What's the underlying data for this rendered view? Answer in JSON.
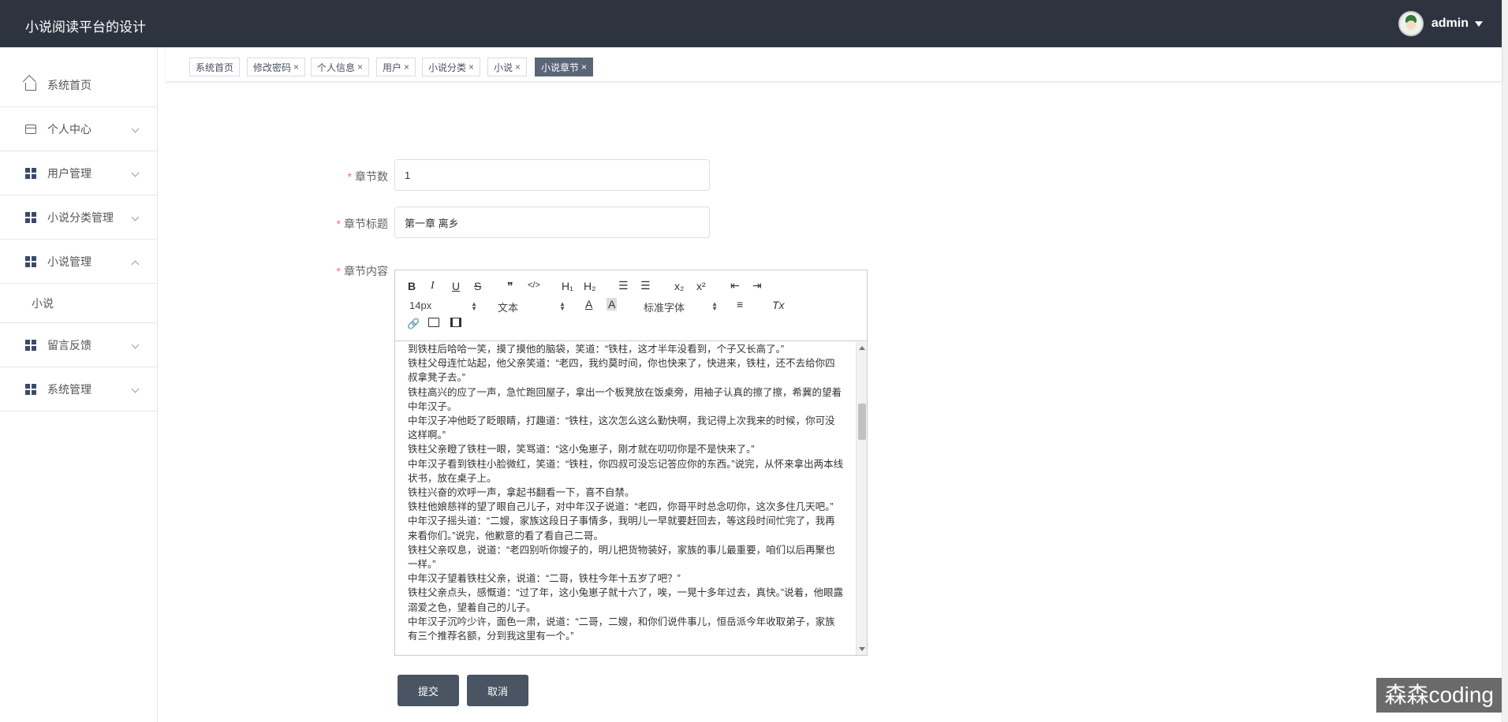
{
  "header": {
    "app_title": "小说阅读平台的设计",
    "user_name": "admin"
  },
  "sidebar": {
    "items": [
      {
        "label": "系统首页",
        "icon": "home-icon"
      },
      {
        "label": "个人中心",
        "icon": "card-icon"
      },
      {
        "label": "用户管理",
        "icon": "grid-icon"
      },
      {
        "label": "小说分类管理",
        "icon": "grid-icon"
      },
      {
        "label": "小说管理",
        "icon": "grid-icon"
      },
      {
        "label": "留言反馈",
        "icon": "grid-icon"
      },
      {
        "label": "系统管理",
        "icon": "grid-icon"
      }
    ],
    "submenu_novel": "小说"
  },
  "tags": [
    {
      "label": "系统首页"
    },
    {
      "label": "修改密码"
    },
    {
      "label": "个人信息"
    },
    {
      "label": "用户"
    },
    {
      "label": "小说分类"
    },
    {
      "label": "小说"
    },
    {
      "label": "小说章节"
    }
  ],
  "tag_close": "×",
  "form": {
    "chapter_num_label": "章节数",
    "chapter_num_value": "1",
    "chapter_title_label": "章节标题",
    "chapter_title_value": "第一章 离乡",
    "chapter_content_label": "章节内容",
    "required_mark": "*"
  },
  "editor": {
    "toolbar": {
      "bold": "B",
      "italic": "I",
      "underline": "U",
      "strike": "S",
      "quote": "❞",
      "code": "</>",
      "h1": "H₁",
      "h2": "H₂",
      "ordered": "☰",
      "bullet": "☰",
      "sub": "x₂",
      "sup": "x²",
      "outdent": "⇤",
      "indent": "⇥",
      "size": "14px",
      "text_type": "文本",
      "font": "标准字体",
      "color": "A",
      "bg": "A",
      "align": "≡",
      "clean": "Tx"
    },
    "paragraphs": [
      "到铁柱后哈哈一笑，摸了摸他的脑袋，笑道：“铁柱，这才半年没看到，个子又长高了。”",
      "铁柱父母连忙站起，他父亲笑道：“老四，我约莫时间，你也快来了，快进来，铁柱，还不去给你四叔拿凳子去。”",
      "铁柱高兴的应了一声，急忙跑回屋子，拿出一个板凳放在饭桌旁，用袖子认真的擦了擦，希冀的望着中年汉子。",
      "中年汉子冲他眨了眨眼睛，打趣道：“铁柱，这次怎么这么勤快啊，我记得上次我来的时候，你可没这样啊。”",
      "铁柱父亲瞪了铁柱一眼，笑骂道：“这小兔崽子，刚才就在叨叨你是不是快来了。”",
      "中年汉子看到铁柱小脸微红，笑道：“铁柱，你四叔可没忘记答应你的东西。”说完，从怀来拿出两本线状书，放在桌子上。",
      "铁柱兴奋的欢呼一声，拿起书翻看一下，喜不自禁。",
      "铁柱他娘慈祥的望了眼自己儿子，对中年汉子说道：“老四，你哥平时总念叨你，这次多住几天吧。”",
      "中年汉子摇头道：“二嫂，家族这段日子事情多，我明儿一早就要赶回去，等这段时间忙完了，我再来看你们。”说完，他歉意的看了看自己二哥。",
      "铁柱父亲叹息，说道：“老四别听你嫂子的，明儿把货物装好，家族的事儿最重要，咱们以后再聚也一样。”",
      "中年汉子望着铁柱父亲，说道：“二哥，铁柱今年十五岁了吧？”",
      "铁柱父亲点头，感慨道：“过了年，这小兔崽子就十六了，唉，一晃十多年过去，真快。”说着，他眼露溺爱之色，望着自己的儿子。",
      "中年汉子沉吟少许，面色一肃，说道：“二哥，二嫂，和你们说件事儿，恒岳派今年收取弟子，家族有三个推荐名额，分到我这里有一个。”"
    ]
  },
  "buttons": {
    "submit": "提交",
    "cancel": "取消"
  },
  "watermark": "森森coding"
}
